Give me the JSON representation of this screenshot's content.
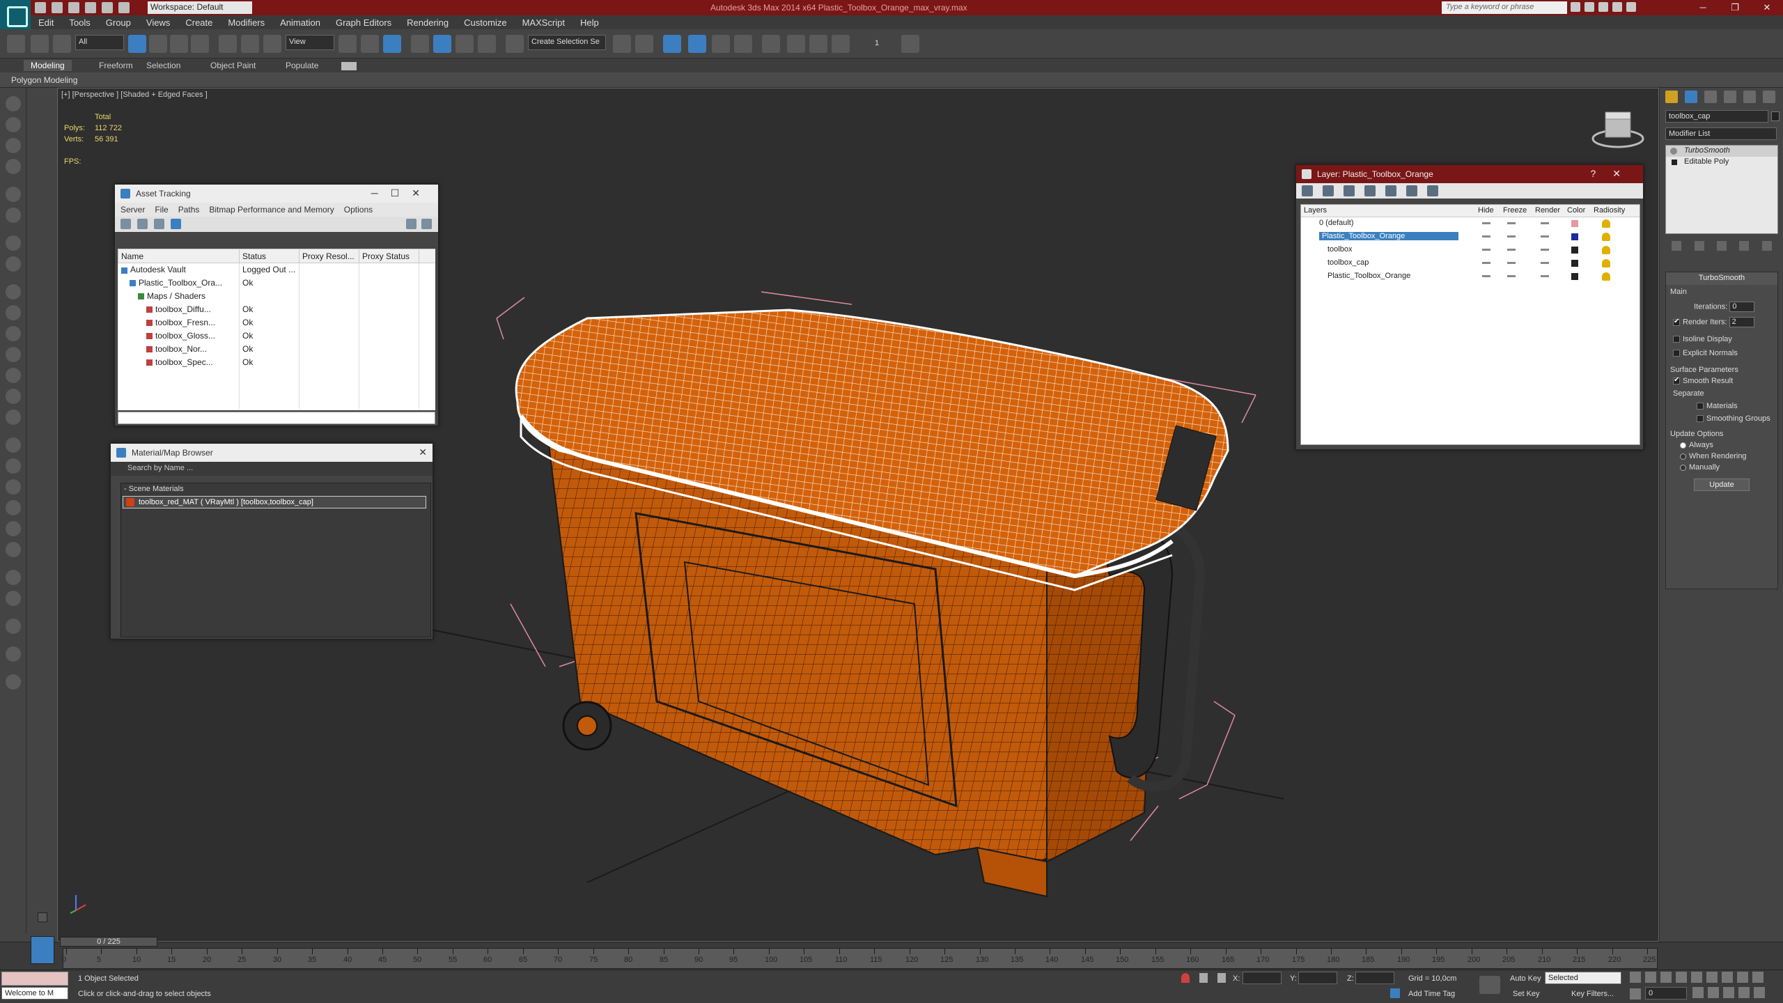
{
  "app": {
    "title": "Autodesk 3ds Max 2014 x64    Plastic_Toolbox_Orange_max_vray.max",
    "workspace": "Workspace: Default",
    "search_placeholder": "Type a keyword or phrase"
  },
  "menu": [
    "Edit",
    "Tools",
    "Group",
    "Views",
    "Create",
    "Modifiers",
    "Animation",
    "Graph Editors",
    "Rendering",
    "Customize",
    "MAXScript",
    "Help"
  ],
  "toolbar": {
    "selection_filter": "All",
    "ref_coord": "View",
    "named_selection": "Create Selection Se",
    "spinner_value": "1"
  },
  "ribbon": {
    "tabs": [
      "Modeling",
      "Freeform",
      "Selection",
      "Object Paint",
      "Populate"
    ],
    "active": "Modeling",
    "subtitle": "Polygon Modeling"
  },
  "viewport": {
    "label": "[+] [Perspective ] [Shaded + Edged Faces ]",
    "stats_header": "Total",
    "polys_label": "Polys:",
    "polys_value": "112 722",
    "verts_label": "Verts:",
    "verts_value": "56 391",
    "fps_label": "FPS:"
  },
  "asset_tracking": {
    "title": "Asset Tracking",
    "menu": [
      "Server",
      "File",
      "Paths",
      "Bitmap Performance and Memory",
      "Options"
    ],
    "columns": [
      "Name",
      "Status",
      "Proxy Resol...",
      "Proxy Status"
    ],
    "rows": [
      {
        "name": "Autodesk Vault",
        "status": "Logged Out ...",
        "indent": 0
      },
      {
        "name": "Plastic_Toolbox_Ora...",
        "status": "Ok",
        "indent": 1
      },
      {
        "name": "Maps / Shaders",
        "status": "",
        "indent": 2
      },
      {
        "name": "toolbox_Diffu...",
        "status": "Ok",
        "indent": 3
      },
      {
        "name": "toolbox_Fresn...",
        "status": "Ok",
        "indent": 3
      },
      {
        "name": "toolbox_Gloss...",
        "status": "Ok",
        "indent": 3
      },
      {
        "name": "toolbox_Nor...",
        "status": "Ok",
        "indent": 3
      },
      {
        "name": "toolbox_Spec...",
        "status": "Ok",
        "indent": 3
      }
    ]
  },
  "material_browser": {
    "title": "Material/Map Browser",
    "search_placeholder": "Search by Name ...",
    "section": "- Scene Materials",
    "item": "toolbox_red_MAT  ( VRayMtl )  [toolbox,toolbox_cap]"
  },
  "layer_window": {
    "title": "Layer: Plastic_Toolbox_Orange",
    "columns": [
      "Layers",
      "Hide",
      "Freeze",
      "Render",
      "Color",
      "Radiosity"
    ],
    "rows": [
      {
        "name": "0 (default)",
        "indent": 1,
        "selected": false,
        "color": "#e59aa0"
      },
      {
        "name": "Plastic_Toolbox_Orange",
        "indent": 1,
        "selected": true,
        "color": "#1a2aa0"
      },
      {
        "name": "toolbox",
        "indent": 2,
        "selected": false,
        "color": "#222222"
      },
      {
        "name": "toolbox_cap",
        "indent": 2,
        "selected": false,
        "color": "#222222"
      },
      {
        "name": "Plastic_Toolbox_Orange",
        "indent": 2,
        "selected": false,
        "color": "#222222"
      }
    ]
  },
  "command_panel": {
    "object_name": "toolbox_cap",
    "modifier_list": "Modifier List",
    "stack": [
      "TurboSmooth",
      "Editable Poly"
    ],
    "turbosmooth": {
      "title": "TurboSmooth",
      "main": "Main",
      "iterations_label": "Iterations:",
      "iterations_value": "0",
      "render_iters_label": "Render Iters:",
      "render_iters_value": "2",
      "isoline": "Isoline Display",
      "explicit_normals": "Explicit Normals",
      "surface_params": "Surface Parameters",
      "smooth_result": "Smooth Result",
      "separate": "Separate",
      "materials": "Materials",
      "smoothing_groups": "Smoothing Groups",
      "update_options": "Update Options",
      "always": "Always",
      "when_rendering": "When Rendering",
      "manually": "Manually",
      "update_button": "Update"
    }
  },
  "timeline": {
    "slider": "0 / 225",
    "ticks": [
      "0",
      "5",
      "10",
      "15",
      "20",
      "25",
      "30",
      "35",
      "40",
      "45",
      "50",
      "55",
      "60",
      "65",
      "70",
      "75",
      "80",
      "85",
      "90",
      "95",
      "100",
      "105",
      "110",
      "115",
      "120",
      "125",
      "130",
      "135",
      "140",
      "145",
      "150",
      "155",
      "160",
      "165",
      "170",
      "175",
      "180",
      "185",
      "190",
      "195",
      "200",
      "205",
      "210",
      "215",
      "220",
      "225"
    ]
  },
  "status": {
    "maxscript": "Welcome to M",
    "selected": "1 Object Selected",
    "prompt": "Click or click-and-drag to select objects",
    "x_label": "X:",
    "y_label": "Y:",
    "z_label": "Z:",
    "grid": "Grid = 10,0cm",
    "add_time_tag": "Add Time Tag",
    "auto_key": "Auto Key",
    "set_key": "Set Key",
    "selected_dd": "Selected",
    "key_filters": "Key Filters...",
    "frame": "0"
  },
  "colors": {
    "title_bar": "#7a1616",
    "model_orange": "#d4620a",
    "wire": "#1a1a1a",
    "selection_white": "#ffffff",
    "bbox_pink": "#e08aa0"
  }
}
